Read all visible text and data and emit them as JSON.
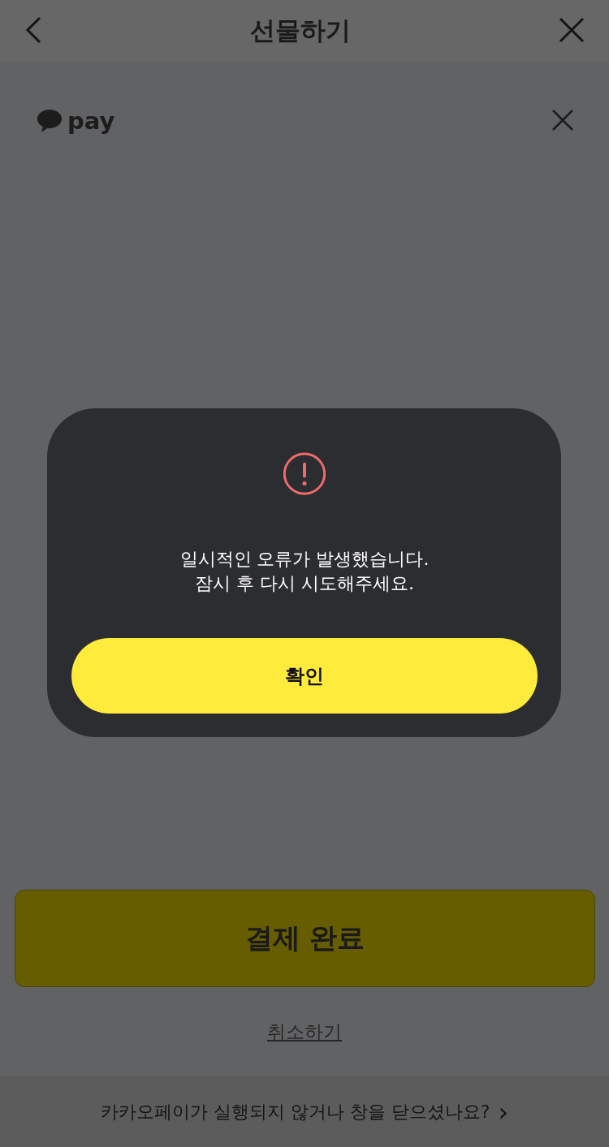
{
  "header": {
    "title": "선물하기"
  },
  "pay_logo": {
    "text": "pay"
  },
  "pay_button": {
    "label": "결제 완료"
  },
  "cancel_link": {
    "label": "취소하기"
  },
  "footer": {
    "text": "카카오페이가 실행되지 않거나 창을 닫으셨나요?",
    "arrow": "›"
  },
  "dialog": {
    "message_lines": [
      "일시적인 오류가 발생했습니다.",
      "잠시 후 다시 시도해주세요."
    ],
    "confirm": "확인"
  }
}
